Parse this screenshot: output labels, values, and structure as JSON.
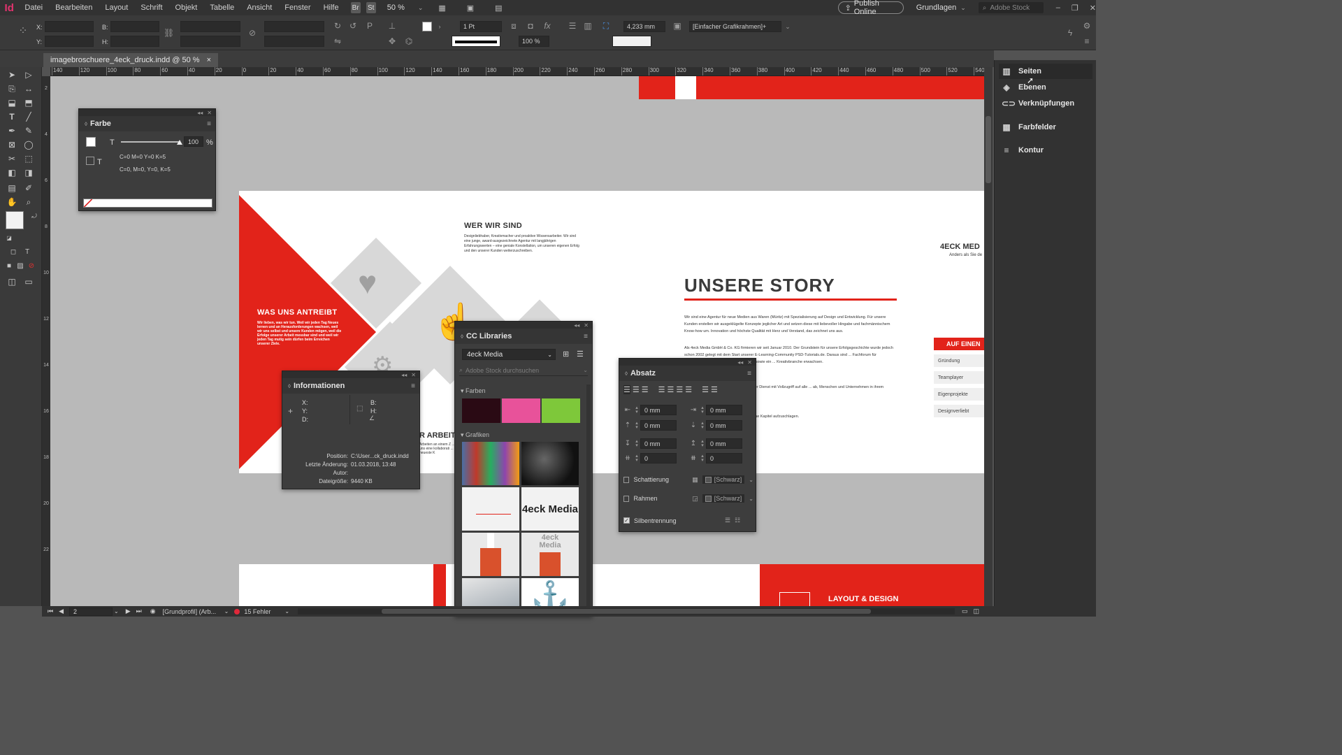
{
  "app": {
    "logo": "Id"
  },
  "menu": [
    "Datei",
    "Bearbeiten",
    "Layout",
    "Schrift",
    "Objekt",
    "Tabelle",
    "Ansicht",
    "Fenster",
    "Hilfe"
  ],
  "menubar_right": {
    "br": "Br",
    "st": "St",
    "zoom": "50 %",
    "publish": "Publish Online",
    "workspace": "Grundlagen",
    "search_placeholder": "Adobe Stock"
  },
  "control": {
    "x_label": "X:",
    "y_label": "Y:",
    "b_label": "B:",
    "h_label": "H:",
    "stroke_weight": "1 Pt",
    "scale": "100 %",
    "gap": "4,233 mm",
    "frame_style": "[Einfacher Grafikrahmen]+"
  },
  "document_tab": {
    "name": "imagebroschuere_4eck_druck.indd @ 50 %",
    "close": "×"
  },
  "ruler_ticks": [
    "140",
    "120",
    "100",
    "80",
    "60",
    "40",
    "20",
    "0",
    "20",
    "40",
    "60",
    "80",
    "100",
    "120",
    "140",
    "160",
    "180",
    "200",
    "220",
    "240",
    "260",
    "280",
    "300",
    "320",
    "340",
    "360",
    "380",
    "400",
    "420",
    "440",
    "460",
    "480",
    "500",
    "520",
    "540"
  ],
  "vruler_labels": [
    "2",
    "4",
    "6",
    "8",
    "10",
    "12",
    "14",
    "16",
    "18",
    "20",
    "22"
  ],
  "right_panels": [
    "Seiten",
    "Ebenen",
    "Verknüpfungen",
    "Farbfelder",
    "Kontur"
  ],
  "farbe_panel": {
    "title": "Farbe",
    "tint_label": "T",
    "tint_value": "100",
    "percent": "%",
    "line1": "C=0 M=0 Y=0 K=5",
    "line2": "C=0, M=0, Y=0, K=5"
  },
  "info_panel": {
    "title": "Informationen",
    "x": "X:",
    "y": "Y:",
    "d": "D:",
    "b": "B:",
    "h": "H:",
    "position_label": "Position:",
    "position_value": "C:\\User...ck_druck.indd",
    "modified_label": "Letzte Änderung:",
    "modified_value": "01.03.2018, 13:48",
    "author_label": "Autor:",
    "author_value": "",
    "size_label": "Dateigröße:",
    "size_value": "9440 KB"
  },
  "cc_panel": {
    "title": "CC Libraries",
    "library": "4eck Media",
    "search_placeholder": "Adobe Stock durchsuchen",
    "farben": "Farben",
    "grafiken": "Grafiken",
    "colors": [
      "#2a0a14",
      "#e8529a",
      "#7ec83a"
    ],
    "logo_text": "4eck Media",
    "logo_small": "4eck Media"
  },
  "absatz_panel": {
    "title": "Absatz",
    "fields": [
      "0 mm",
      "0 mm",
      "0 mm",
      "0 mm",
      "0 mm",
      "0 mm",
      "0",
      "0"
    ],
    "schattierung": "Schattierung",
    "rahmen": "Rahmen",
    "swatch": "[Schwarz]",
    "silbentrennung": "Silbentrennung"
  },
  "doc": {
    "wer_wir_sind": "WER WIR SIND",
    "wer_text": "Designliebhaber, Kreativmacher und proaktive Wissensarbeiter. Wir sind eine junge, award-ausgezeichnete Agentur mit langjährigen Erfahrungswerten – eine geniale Konstellation, um unseren eigenen Erfolg und den unserer Kunden weiterzuschreiben.",
    "was_uns": "WAS UNS ANTREIBT",
    "was_text": "Wir lieben, was wir tun. Weil wir jeden Tag Neues lernen und an Herausforderungen wachsen, weil wir uns selbst und unsere Kunden mögen, weil die Erfolge unserer Arbeit messbar sind und weil wir jeden Tag mutig sein dürfen beim Erreichen unserer Ziele.",
    "unsere_story": "UNSERE STORY",
    "story_p1": "Wir sind eine Agentur für neue Medien aus Waren (Müritz) mit Spezialisierung auf Design und Entwicklung. Für unsere Kunden erstellen wir ausgeklügelte Konzepte jeglicher Art und setzen diese mit liebevoller Hingabe und fachmännischem Know-how um. Innovation und höchste Qualität mit Herz und Verstand, das zeichnet uns aus.",
    "story_p2": "Als 4eck Media GmbH & Co. KG firmieren wir seit Januar 2010. Der Grundstein für unsere Erfolgsgeschichte wurde jedoch schon 2002 gelegt mit dem Start unserer E-Learning-Community PSD-Tutorials.de. Daraus sind ... Fachforum für Bildbearbeitung, Design und Entwicklung sowie ein ... Kreativbranche erwachsen.",
    "story_p3": "... 2015 die Kreativ-Flatrate TutKit.com. Der Dienst mit Vollzugriff auf alle ... ab, Menschen und Unternehmen in ihrem eigenen Wirken und Schaffen ...",
    "story_p4": "... uns, mit Machern ähnlicher Gangart neue Kapitel aufzuschlagen.",
    "brand": "4ECK MED",
    "brand_sub": "Anders als Sie de",
    "auf_einen": "AUF EINEN",
    "side_buttons": [
      "Gründung",
      "Teamplayer",
      "Eigenprojekte",
      "Designverliebt"
    ],
    "arbeit": "R ARBEIT",
    "arbeit_text": "Arbeiten an einem Z ... uns eine kollaborati ... und neueste K",
    "layout_design": "LAYOUT & DESIGN"
  },
  "status": {
    "page": "2",
    "profile": "[Grundprofil] (Arb...",
    "errors": "15 Fehler"
  }
}
